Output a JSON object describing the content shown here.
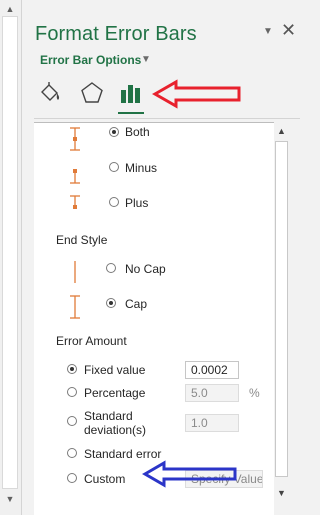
{
  "pane": {
    "title": "Format Error Bars",
    "menu_glyph": "▼",
    "close_glyph": "✕",
    "options_dropdown": "Error Bar Options",
    "options_caret": "▼",
    "tabs": [
      "fill-line-icon",
      "effects-icon",
      "error-bar-options-icon"
    ]
  },
  "direction": {
    "options": [
      {
        "label": "Both",
        "checked": true
      },
      {
        "label": "Minus",
        "checked": false
      },
      {
        "label": "Plus",
        "checked": false
      }
    ]
  },
  "end_style": {
    "heading": "End Style",
    "options": [
      {
        "label": "No Cap",
        "checked": false
      },
      {
        "label": "Cap",
        "checked": true
      }
    ]
  },
  "error_amount": {
    "heading": "Error Amount",
    "fixed_value": {
      "label": "Fixed value",
      "value": "0.0002",
      "checked": true
    },
    "percentage": {
      "label": "Percentage",
      "value": "5.0",
      "unit": "%"
    },
    "std_deviation": {
      "label_line1": "Standard",
      "label_line2": "deviation(s)",
      "value": "1.0"
    },
    "std_error": {
      "label": "Standard error"
    },
    "custom": {
      "label": "Custom",
      "button": "Specify Value"
    }
  },
  "annotation_colors": {
    "red_arrow": "#e8212d",
    "blue_arrow": "#2b35c8"
  },
  "colors": {
    "accent": "#217346",
    "marker": "#e07b39"
  }
}
